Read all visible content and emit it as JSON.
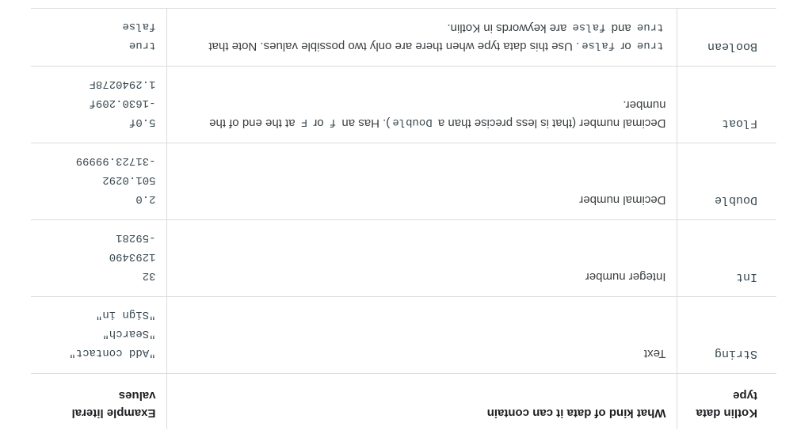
{
  "table": {
    "headers": {
      "type": "Kotlin data type",
      "kind": "What kind of data it can contain",
      "examples": "Example literal values"
    },
    "rows": [
      {
        "type": "String",
        "kind": "Text",
        "examples": [
          "\"Add contact\"",
          "\"Search\"",
          "\"Sign in\""
        ]
      },
      {
        "type": "Int",
        "kind": "Integer number",
        "examples": [
          "32",
          "1293490",
          "-59281"
        ]
      },
      {
        "type": "Double",
        "kind": "Decimal number",
        "examples": [
          "2.0",
          "501.0292",
          "-31723.99999"
        ]
      },
      {
        "type": "Float",
        "kind_parts": {
          "p1": "Decimal number (that is less precise than a",
          "c1": "Double",
          "p2": "). Has an",
          "c2": "f",
          "p3": "or",
          "c3": "F",
          "p4": "at the end of the number."
        },
        "examples": [
          "5.0f",
          "-1630.209f",
          "1.2940278F"
        ]
      },
      {
        "type": "Boolean",
        "kind_parts": {
          "c1": "true",
          "p1": "or",
          "c2": "false",
          "p2": ". Use this data type when there are only two possible values. Note that",
          "c3": "true",
          "p3": "and",
          "c4": "false",
          "p4": "are keywords in Kotlin."
        },
        "examples": [
          "true",
          "false"
        ]
      }
    ]
  }
}
